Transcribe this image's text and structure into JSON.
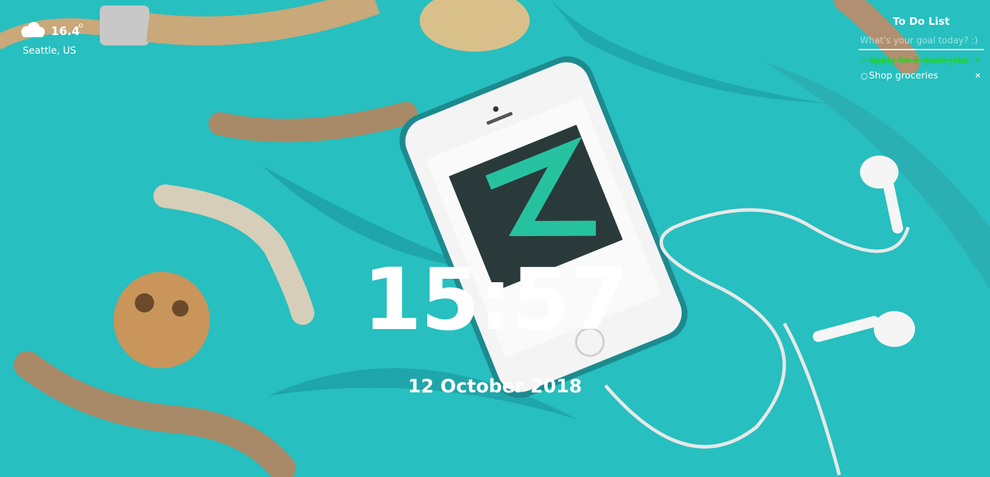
{
  "weather": {
    "icon": "cloud-icon",
    "temperature": "16.4",
    "degree_symbol": "o",
    "location": "Seattle, US"
  },
  "todo": {
    "title": "To Do List",
    "placeholder": "What's your goal today? :)",
    "items": [
      {
        "text": "Apply for 5 more jobs",
        "done": true,
        "mark": "✓",
        "delete": "×"
      },
      {
        "text": "Shop groceries",
        "done": false,
        "mark": "○",
        "delete": "×"
      }
    ],
    "done_color": "#1fd11f"
  },
  "clock": {
    "time": "15:57"
  },
  "date": {
    "text": "12 October 2018"
  },
  "background": {
    "color": "#27bfbf",
    "description_icons": [
      "rope",
      "driftwood",
      "loofah",
      "feather",
      "smartphone",
      "earphones"
    ]
  }
}
